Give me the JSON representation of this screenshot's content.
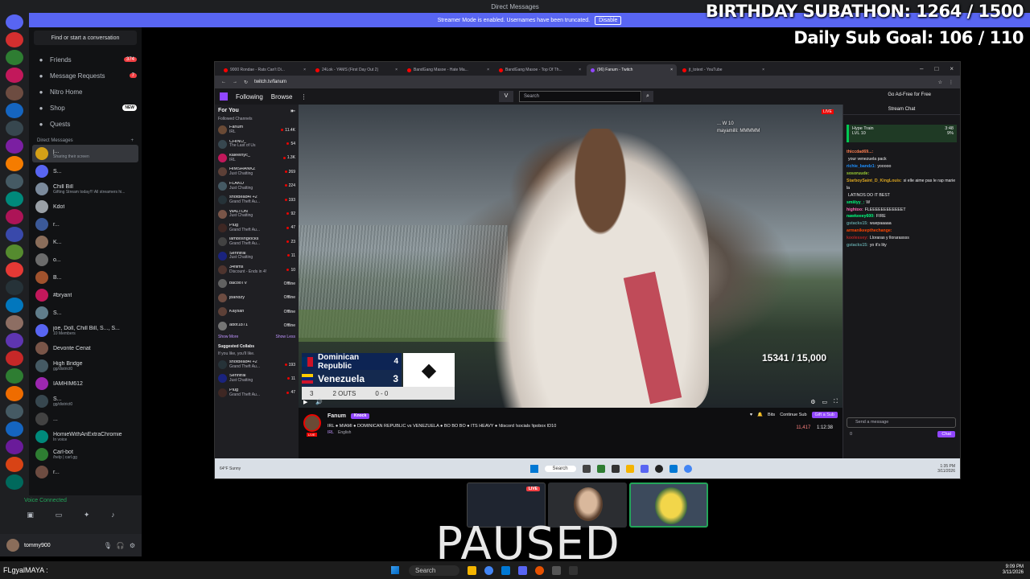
{
  "discord": {
    "window_title": "Direct Messages",
    "banner_text": "Streamer Mode is enabled. Usernames have been truncated.",
    "banner_button": "Disable",
    "find_placeholder": "Find or start a conversation",
    "nav": [
      {
        "label": "Friends",
        "badge": "374",
        "icon": "friends-icon"
      },
      {
        "label": "Message Requests",
        "badge": "7",
        "icon": "inbox-icon"
      },
      {
        "label": "Nitro Home",
        "badge": "",
        "icon": "nitro-icon"
      },
      {
        "label": "Shop",
        "badge": "NEW",
        "icon": "shop-icon"
      },
      {
        "label": "Quests",
        "badge": "",
        "icon": "quests-icon"
      }
    ],
    "dm_header": "Direct Messages",
    "dm_add": "+",
    "dms": [
      {
        "name": "j...",
        "sub": "Sharing their screen",
        "color": "#d4a017"
      },
      {
        "name": "S...",
        "sub": "",
        "color": "#5865f2"
      },
      {
        "name": "Chill Bill",
        "sub": "Gifting Stream today!!! All streamers hi...",
        "color": "#7b8a9c"
      },
      {
        "name": "Kdot",
        "sub": "",
        "color": "#9aa0a6"
      },
      {
        "name": "r...",
        "sub": "",
        "color": "#3b5998"
      },
      {
        "name": "K...",
        "sub": "",
        "color": "#8a6d5a"
      },
      {
        "name": "o...",
        "sub": "",
        "color": "#6b6b6b"
      },
      {
        "name": "B...",
        "sub": "",
        "color": "#a0522d"
      },
      {
        "name": "#bryant",
        "sub": "",
        "color": "#c2185b"
      },
      {
        "name": "S...",
        "sub": "",
        "color": "#607d8b"
      },
      {
        "name": "joe, Doll, Chill Bill, S..., S...",
        "sub": "10 Members",
        "color": "#5865f2"
      },
      {
        "name": "Devonte Cenat",
        "sub": "",
        "color": "#795548"
      },
      {
        "name": "High Bridge",
        "sub": "gg/district0",
        "color": "#455a64"
      },
      {
        "name": "IAMHIM612",
        "sub": "",
        "color": "#9c27b0"
      },
      {
        "name": "S...",
        "sub": "gg/district0",
        "color": "#37474f"
      },
      {
        "name": "...",
        "sub": "",
        "color": "#424242"
      },
      {
        "name": "HomieWithAnExtraChromie",
        "sub": "In voice",
        "color": "#00897b"
      },
      {
        "name": "Carl-bot",
        "sub": "/help | carl.gg",
        "color": "#2e7d32"
      },
      {
        "name": "r...",
        "sub": "",
        "color": "#6d4c41"
      }
    ],
    "voice_status": "Voice Connected",
    "username": "tommy900",
    "overlay_line1": "BIRTHDAY SUBATHON: 1264 / 1500",
    "overlay_line2": "Daily Sub Goal:  106 / 110"
  },
  "browser": {
    "tabs": [
      {
        "label": "9000 Rondae - Rats Can't Di...",
        "color": "#ff0000"
      },
      {
        "label": "24Lok - YAMS (First Day Out 2)",
        "color": "#ff0000"
      },
      {
        "label": "BandGang Masoe - Hate Ma...",
        "color": "#ff0000"
      },
      {
        "label": "BandGang Masoe - Top Of Th...",
        "color": "#ff0000"
      },
      {
        "label": "(96) Fanum - Twitch",
        "color": "#9146ff"
      },
      {
        "label": "jt_totext - YouTube",
        "color": "#ff0000"
      }
    ],
    "url": "twitch.tv/fanum"
  },
  "twitch": {
    "nav_following": "Following",
    "nav_browse": "Browse",
    "search_placeholder": "Search",
    "ad_free": "Go Ad-Free for Free",
    "for_you": "For You",
    "followed_channels": "Followed Channels",
    "channels": [
      {
        "name": "Fanum",
        "game": "IRL",
        "viewers": "11.4K",
        "live": true,
        "color": "#6a4a35"
      },
      {
        "name": "CHINO_",
        "game": "The Last of Us",
        "viewers": "54",
        "live": true,
        "color": "#37474f"
      },
      {
        "name": "kaleeinyc_",
        "game": "IRL",
        "viewers": "1.3K",
        "live": true,
        "color": "#c2185b"
      },
      {
        "name": "HIMSHANKZ",
        "game": "Just Chatting",
        "viewers": "269",
        "live": true,
        "color": "#5d4037"
      },
      {
        "name": "FLAKO",
        "game": "Just Chatting",
        "viewers": "224",
        "live": true,
        "color": "#455a64"
      },
      {
        "name": "shotdead4l +2",
        "game": "Grand Theft Au...",
        "viewers": "193",
        "live": true,
        "color": "#263238"
      },
      {
        "name": "WALTON",
        "game": "Just Chatting",
        "viewers": "92",
        "live": true,
        "color": "#795548"
      },
      {
        "name": "Plug",
        "game": "Grand Theft Au...",
        "viewers": "47",
        "live": true,
        "color": "#3e2723"
      },
      {
        "name": "lambosngiocks",
        "game": "Grand Theft Au...",
        "viewers": "23",
        "live": true,
        "color": "#424242"
      },
      {
        "name": "Sehntral",
        "game": "Just Chatting",
        "viewers": "11",
        "live": true,
        "color": "#1a237e"
      },
      {
        "name": "34films",
        "game": "Discount - Ends in 4!",
        "viewers": "10",
        "live": true,
        "color": "#4e342e"
      },
      {
        "name": "bacooTV",
        "game": "",
        "viewers": "Offline",
        "live": false,
        "color": "#616161"
      },
      {
        "name": "jbandzy",
        "game": "",
        "viewers": "Offline",
        "live": false,
        "color": "#6d4c41"
      },
      {
        "name": "Kaysan",
        "game": "",
        "viewers": "Offline",
        "live": false,
        "color": "#5d4037"
      },
      {
        "name": "adot1871",
        "game": "",
        "viewers": "Offline",
        "live": false,
        "color": "#757575"
      }
    ],
    "show_more": "Show More",
    "show_less": "Show Less",
    "suggested_title": "Suggested Collabs",
    "suggested_sub": "If you like, you'll like.",
    "suggested": [
      {
        "name": "shotdead4l +2",
        "game": "Grand Theft Au...",
        "viewers": "193",
        "color": "#263238"
      },
      {
        "name": "Sehntral",
        "game": "Just Chatting",
        "viewers": "11",
        "color": "#1a237e"
      },
      {
        "name": "Plug",
        "game": "Grand Theft Au...",
        "viewers": "47",
        "color": "#3e2723"
      }
    ],
    "scoreboard": {
      "team1": "Dominican Republic",
      "score1": "4",
      "team2": "Venezuela",
      "score2": "3",
      "inning": "3",
      "outs": "2 OUTS",
      "count": "0 - 0"
    },
    "sub_counter": "15341 / 15,000",
    "live_badge": "LIVE",
    "video_chat": [
      "... W 10",
      "mayamilli: MMMMM"
    ],
    "streamer": "Fanum",
    "knock": "Knock",
    "stream_title": "IRL ● MIAMI ● DOMINICAN REPUBLIC vs VENEZUELA ● BO BO BO ● ITS HEAVY ● !discord !socials !ipobox ID10",
    "category": "IRL",
    "language": "English",
    "bits_label": "Bits",
    "continue_sub": "Continue Sub",
    "gift_sub": "Gift a Sub",
    "viewers": "11,417",
    "uptime": "1:12:38",
    "chat_title": "Stream Chat",
    "hype_train": "Hype Train",
    "hype_level": "LVL 10",
    "hype_time": "3:48",
    "hype_pct": "9%",
    "chat_messages": [
      {
        "user": "thiccdad69...:",
        "text": "",
        "color": "#ff7f50"
      },
      {
        "user": "",
        "text": "your venezuela pack",
        "color": "#efeff1"
      },
      {
        "user": "richie_bandz1:",
        "text": "yooooo",
        "color": "#1e90ff"
      },
      {
        "user": "sosoruude:",
        "text": "",
        "color": "#9acd32"
      },
      {
        "user": "StarboySaint_D_KingLouis:",
        "text": "si elle aime pas le rap marie la",
        "color": "#daa520"
      },
      {
        "user": "",
        "text": "LATINOS DO IT BEST",
        "color": "#efeff1"
      },
      {
        "user": "smiiiyy_:",
        "text": "W",
        "color": "#00ff7f"
      },
      {
        "user": "hightoo:",
        "text": "FLEEEEEEEEEEEET",
        "color": "#ff69b4"
      },
      {
        "user": "nawkeeey600:",
        "text": "FIRE",
        "color": "#00ff7f"
      },
      {
        "user": "gstacks15:",
        "text": "wuepaaaaa",
        "color": "#5f9ea0"
      },
      {
        "user": "armanikeepthechange:",
        "text": "",
        "color": "#ff4500"
      },
      {
        "user": "koolessey:",
        "text": "Lloraras y llorarassss",
        "color": "#b22222"
      },
      {
        "user": "gstacks15:",
        "text": "yo it's lity",
        "color": "#5f9ea0"
      }
    ],
    "chat_placeholder": "Send a message",
    "chat_points": "0",
    "chat_button": "Chat"
  },
  "inner_taskbar": {
    "weather": "64°F Sunny",
    "search": "Search",
    "clock_time": "1:35 PM",
    "clock_date": "3/11/2026"
  },
  "thumbs": {
    "live": "LIVE"
  },
  "paused_text": "PAUSED",
  "taskbar": {
    "user": "FLgyalMAYA :",
    "search": "Search",
    "time": "9:09 PM",
    "date": "3/11/2026"
  }
}
